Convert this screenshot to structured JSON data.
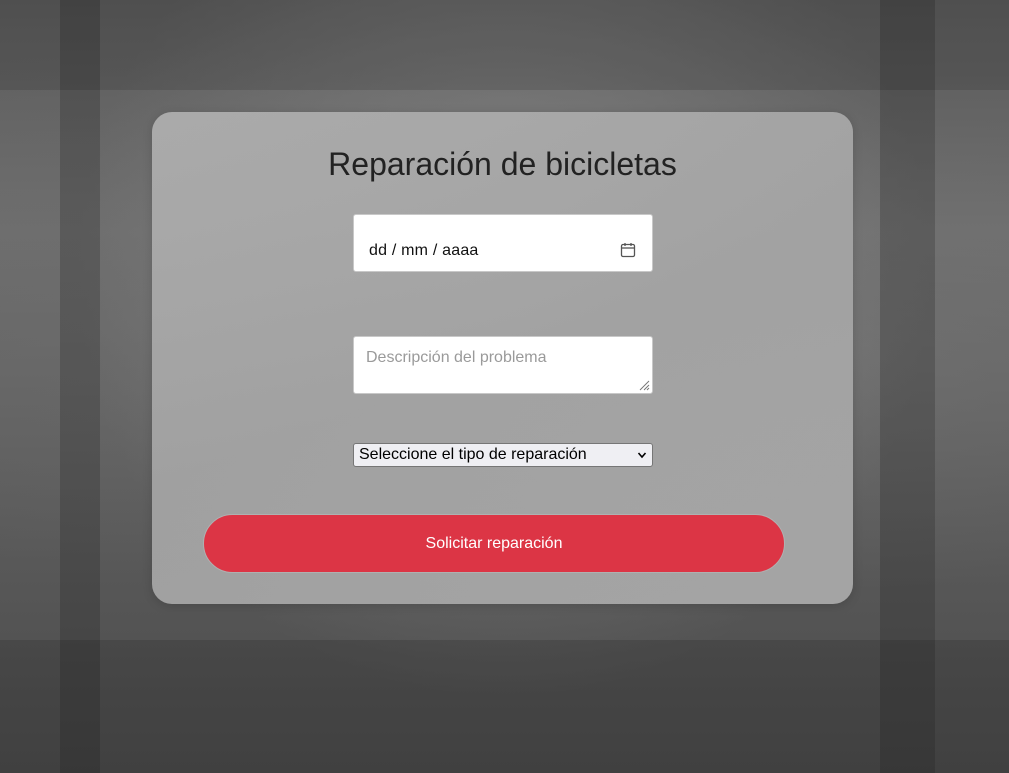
{
  "form": {
    "title": "Reparación de bicicletas",
    "date_field": {
      "placeholder": "dd / mm / aaaa",
      "icon": "calendar-icon"
    },
    "description_field": {
      "placeholder": "Descripción del problema"
    },
    "repair_type_select": {
      "selected_label": "Seleccione el tipo de reparación",
      "icon": "chevron-down-icon"
    },
    "submit_label": "Solicitar reparación"
  },
  "colors": {
    "submit_button": "#dc3545",
    "title_text": "#222222",
    "placeholder_text": "#9a9a9a"
  }
}
